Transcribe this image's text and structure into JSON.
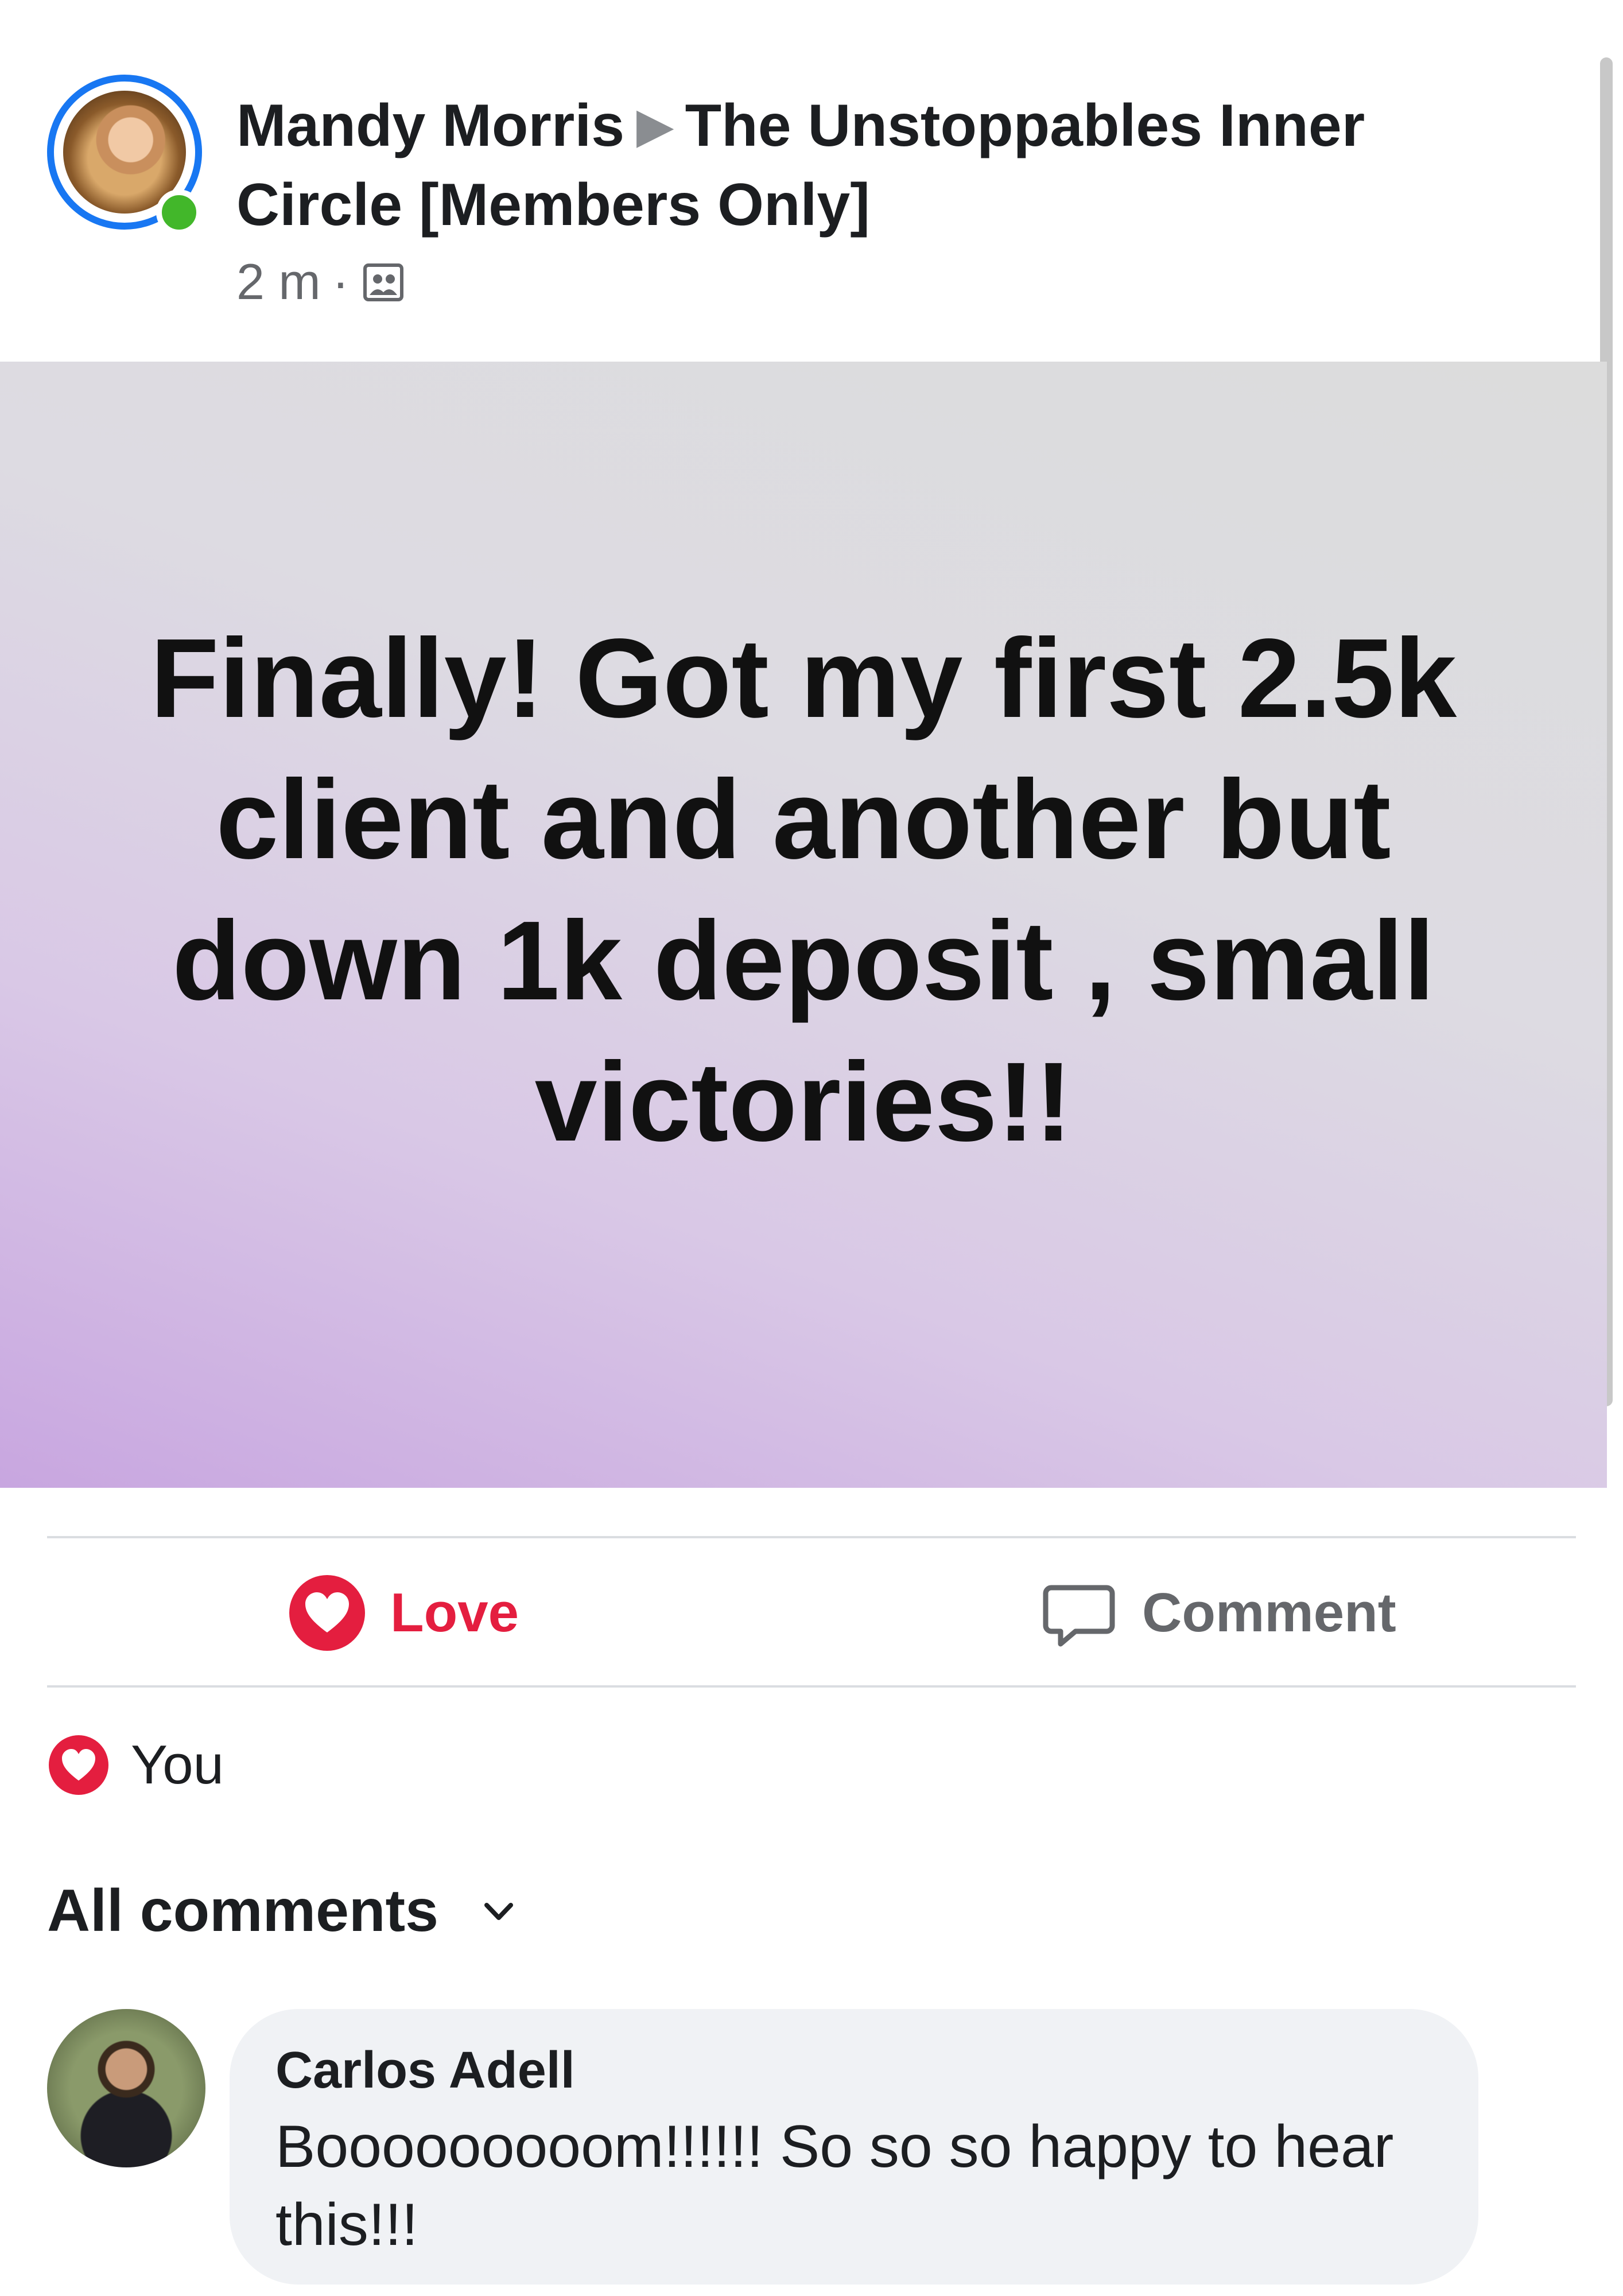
{
  "post": {
    "author": "Mandy Morris",
    "group": "The Unstoppables Inner Circle [Members Only]",
    "time": "2 m",
    "separator": "·",
    "text": "Finally! Got my first 2.5k client and another but down 1k deposit , small victories!!",
    "background_colors": [
      "#c8a6e0",
      "#dddbe2",
      "#dcdcdc"
    ],
    "author_status": "online"
  },
  "actions": {
    "love_label": "Love",
    "comment_label": "Comment"
  },
  "reactions": {
    "label": "You",
    "icon": "heart-icon"
  },
  "comments_filter": {
    "label": "All comments"
  },
  "comments": [
    {
      "author": "Carlos Adell",
      "text": "Booooooooom!!!!!! So so so happy to hear this!!!"
    }
  ],
  "colors": {
    "love_red": "#e41e3f",
    "online_green": "#42b72a",
    "story_ring_blue": "#1877f2",
    "muted_text": "#65676b"
  }
}
